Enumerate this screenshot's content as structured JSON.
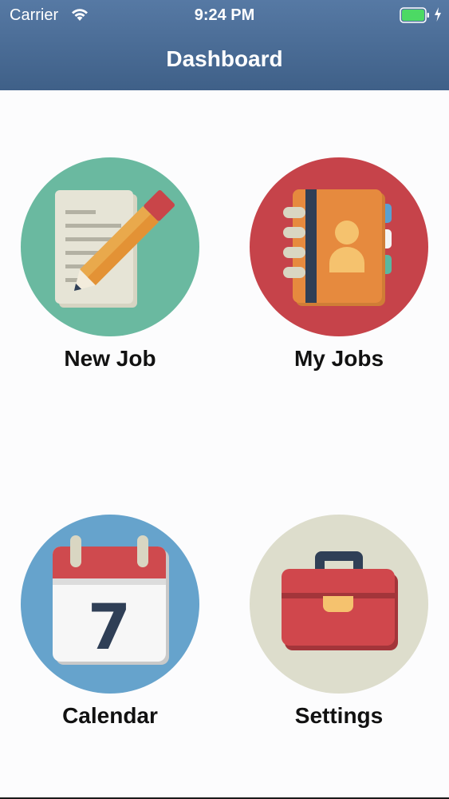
{
  "status_bar": {
    "carrier": "Carrier",
    "time": "9:24 PM",
    "battery_color": "#4cd964"
  },
  "nav": {
    "title": "Dashboard",
    "bar_color": "#46668f"
  },
  "tiles": [
    {
      "label": "New Job",
      "icon": "pencil-document-icon",
      "circle_color": "#6ab9a0"
    },
    {
      "label": "My Jobs",
      "icon": "address-book-icon",
      "circle_color": "#c6434a"
    },
    {
      "label": "Calendar",
      "icon": "calendar-icon",
      "circle_color": "#66a3cc",
      "day": "7"
    },
    {
      "label": "Settings",
      "icon": "toolbox-icon",
      "circle_color": "#ddddcc"
    }
  ]
}
